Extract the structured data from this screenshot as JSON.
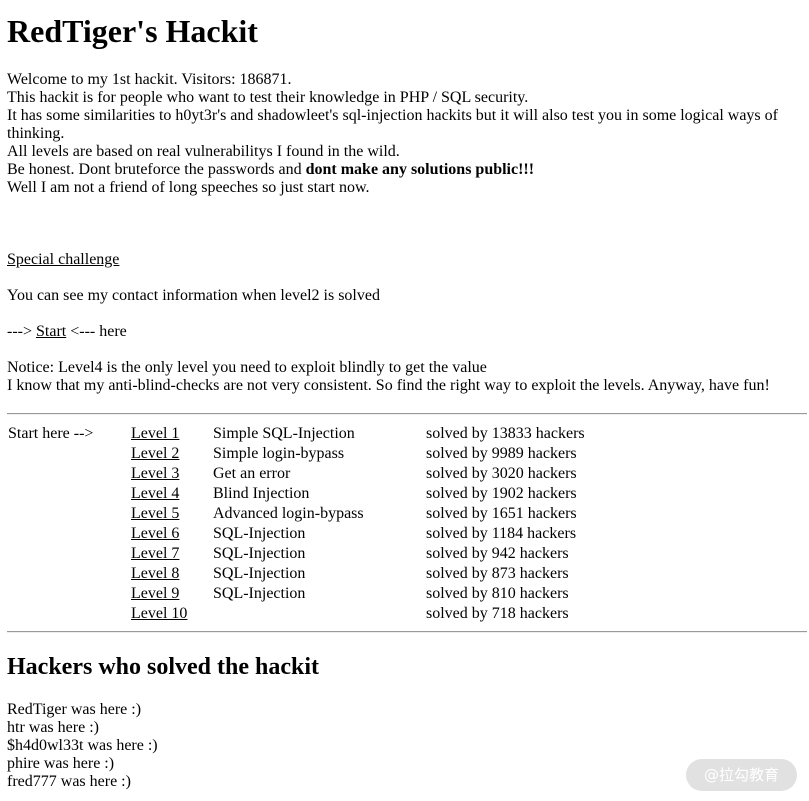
{
  "title": "RedTiger's Hackit",
  "intro": {
    "line1": "Welcome to my 1st hackit. Visitors: 186871.",
    "line2": "This hackit is for people who want to test their knowledge in PHP / SQL security.",
    "line3": "It has some similarities to h0yt3r's and shadowleet's sql-injection hackits but it will also test you in some logical ways of thinking.",
    "line4": "All levels are based on real vulnerabilitys I found in the wild.",
    "line5_prefix": "Be honest. Dont bruteforce the passwords and ",
    "line5_bold": "dont make any solutions public!!!",
    "line6": "Well I am not a friend of long speeches so just start now."
  },
  "special_challenge": "Special challenge",
  "contact_note": "You can see my contact information when level2 is solved",
  "start": {
    "prefix": "---> ",
    "link": "Start",
    "suffix": " <--- here"
  },
  "notice": {
    "line1": "Notice: Level4 is the only level you need to exploit blindly to get the value",
    "line2": "I know that my anti-blind-checks are not very consistent. So find the right way to exploit the levels. Anyway, have fun!"
  },
  "levels": {
    "start_here": "Start here -->",
    "rows": [
      {
        "name": "Level 1",
        "desc": "Simple SQL-Injection",
        "solved": "solved by 13833 hackers"
      },
      {
        "name": "Level 2",
        "desc": "Simple login-bypass",
        "solved": "solved by 9989 hackers"
      },
      {
        "name": "Level 3",
        "desc": "Get an error",
        "solved": "solved by 3020 hackers"
      },
      {
        "name": "Level 4",
        "desc": "Blind Injection",
        "solved": "solved by 1902 hackers"
      },
      {
        "name": "Level 5",
        "desc": "Advanced login-bypass",
        "solved": "solved by 1651 hackers"
      },
      {
        "name": "Level 6",
        "desc": "SQL-Injection",
        "solved": "solved by 1184 hackers"
      },
      {
        "name": "Level 7",
        "desc": "SQL-Injection",
        "solved": "solved by 942 hackers"
      },
      {
        "name": "Level 8",
        "desc": "SQL-Injection",
        "solved": "solved by 873 hackers"
      },
      {
        "name": "Level 9",
        "desc": "SQL-Injection",
        "solved": "solved by 810 hackers"
      },
      {
        "name": "Level 10",
        "desc": "",
        "solved": "solved by 718 hackers"
      }
    ]
  },
  "hackers_heading": "Hackers who solved the hackit",
  "hackers": [
    "RedTiger was here :)",
    "htr was here :)",
    "$h4d0wl33t was here :)",
    "phire was here :)",
    "fred777 was here :)"
  ],
  "watermark": "@拉勾教育"
}
